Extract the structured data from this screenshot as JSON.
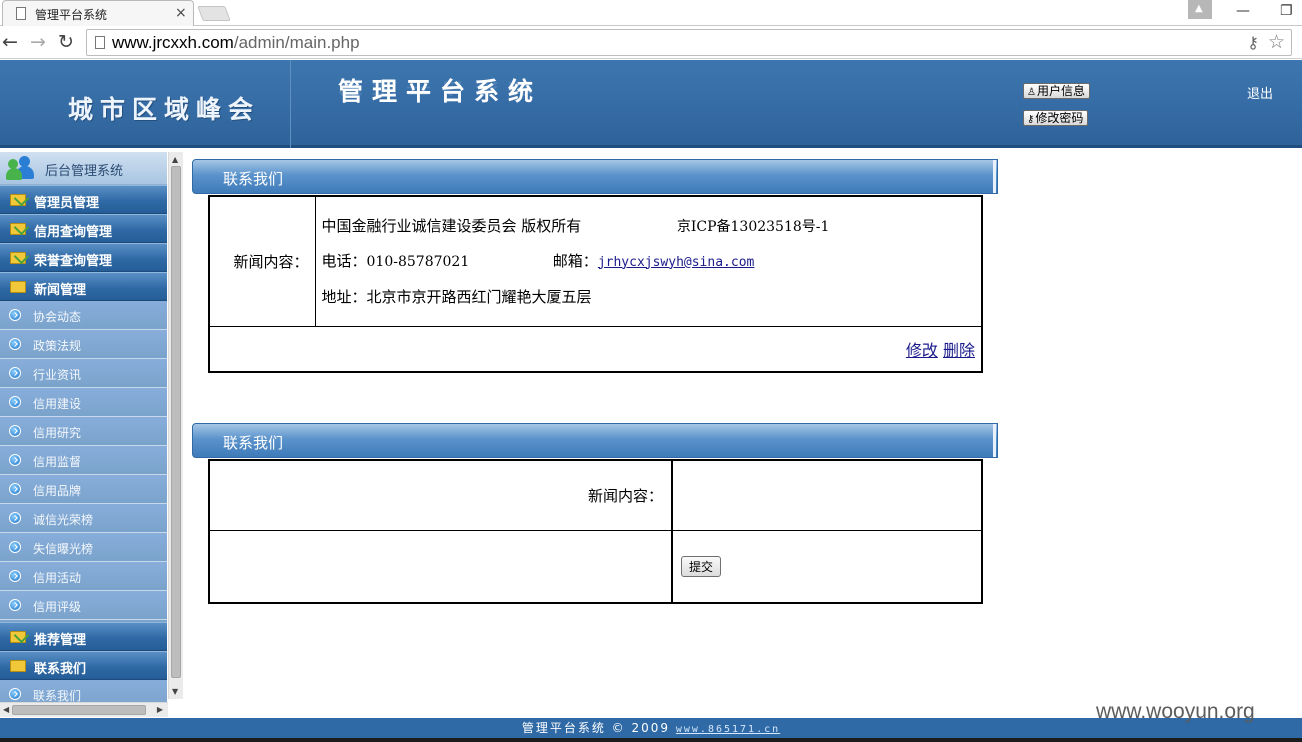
{
  "browser": {
    "tab_title": "管理平台系统",
    "tab_close": "×",
    "url_host": "www.jrcxxh.com",
    "url_path": "/admin/main.php",
    "back_icon": "←",
    "forward_icon": "→",
    "reload_icon": "↻",
    "minimize_icon": "—",
    "restore_icon": "❐",
    "key_icon": "⚷",
    "star_icon": "☆"
  },
  "header": {
    "logo_text": "城市区域峰会",
    "app_title": "管理平台系统",
    "user_info": "用户信息",
    "change_password": "修改密码",
    "logout": "退出",
    "user_icon": "♙",
    "key_icon": "⚷"
  },
  "sidebar": {
    "title": "后台管理系统",
    "groups": [
      {
        "label": "管理员管理"
      },
      {
        "label": "信用查询管理"
      },
      {
        "label": "荣誉查询管理"
      },
      {
        "label": "新闻管理"
      }
    ],
    "news_items": [
      {
        "label": "协会动态"
      },
      {
        "label": "政策法规"
      },
      {
        "label": "行业资讯"
      },
      {
        "label": "信用建设"
      },
      {
        "label": "信用研究"
      },
      {
        "label": "信用监督"
      },
      {
        "label": "信用品牌"
      },
      {
        "label": "诚信光荣榜"
      },
      {
        "label": "失信曝光榜"
      },
      {
        "label": "信用活动"
      },
      {
        "label": "信用评级"
      }
    ],
    "bottom_groups": [
      {
        "label": "推荐管理"
      },
      {
        "label": "联系我们"
      }
    ],
    "contact_items": [
      {
        "label": "联系我们"
      }
    ]
  },
  "main": {
    "panel1": {
      "title": "联系我们",
      "field_label": "新闻内容：",
      "line1_org": "中国金融行业诚信建设委员会 版权所有",
      "line1_icp": "京ICP备13023518号-1",
      "line2_phone_label": "电话：",
      "line2_phone": "010-85787021",
      "line2_email_label": "邮箱：",
      "line2_email": "jrhycxjswyh@sina.com",
      "line3_address": "地址：北京市京开路西红门耀艳大厦五层",
      "edit_link": "修改",
      "delete_link": "删除"
    },
    "panel2": {
      "title": "联系我们",
      "field_label": "新闻内容：",
      "submit_label": "提交"
    }
  },
  "footer": {
    "text": "管理平台系统 © 2009",
    "link": "www.865171.cn"
  },
  "watermark": "www.wooyun.org",
  "colors": {
    "header_blue": "#356ba4",
    "sidebar_blue": "#7aa3cb",
    "footer_blue": "#2f6aa6",
    "link": "#1a1a8c"
  }
}
